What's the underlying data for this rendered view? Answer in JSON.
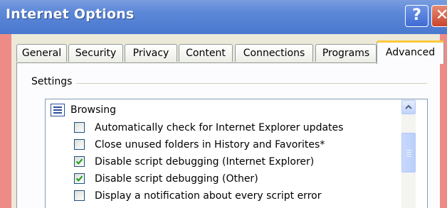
{
  "window": {
    "title": "Internet Options",
    "controls": {
      "help": "?",
      "close": "✕"
    }
  },
  "tabs": [
    {
      "label": "General"
    },
    {
      "label": "Security"
    },
    {
      "label": "Privacy"
    },
    {
      "label": "Content"
    },
    {
      "label": "Connections"
    },
    {
      "label": "Programs"
    },
    {
      "label": "Advanced",
      "active": true
    }
  ],
  "settings": {
    "group_label": "Settings",
    "category": {
      "label": "Browsing",
      "icon": "list-category-icon"
    },
    "items": [
      {
        "label": "Automatically check for Internet Explorer updates",
        "checked": false
      },
      {
        "label": "Close unused folders in History and Favorites*",
        "checked": false
      },
      {
        "label": "Disable script debugging (Internet Explorer)",
        "checked": true
      },
      {
        "label": "Disable script debugging (Other)",
        "checked": true
      },
      {
        "label": "Display a notification about every script error",
        "checked": false
      }
    ]
  },
  "colors": {
    "titlebar": "#5d88d8",
    "active_tab_accent": "#ffc73c",
    "check": "#21a121",
    "frame": "#ef8b86"
  }
}
